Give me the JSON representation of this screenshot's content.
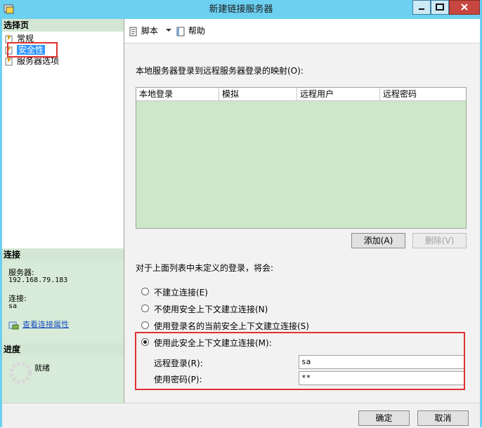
{
  "window": {
    "title": "新建链接服务器"
  },
  "left": {
    "select_page_header": "选择页",
    "pages": [
      {
        "label": "常规",
        "icon": "page-icon"
      },
      {
        "label": "安全性",
        "icon": "page-icon"
      },
      {
        "label": "服务器选项",
        "icon": "page-icon"
      }
    ],
    "connection": {
      "header": "连接",
      "server_label": "服务器:",
      "server_value": "192.168.79.183",
      "connection_label": "连接:",
      "connection_value": "sa",
      "view_props_link": "查看连接属性"
    },
    "progress": {
      "header": "进度",
      "status": "就绪"
    }
  },
  "toolbar": {
    "script_label": "脚本",
    "help_label": "帮助"
  },
  "main": {
    "mapping_label": "本地服务器登录到远程服务器登录的映射(O):",
    "columns": [
      "本地登录",
      "模拟",
      "远程用户",
      "远程密码"
    ],
    "add_button": "添加(A)",
    "delete_button": "删除(V)",
    "undefined_label": "对于上面列表中未定义的登录，将会:",
    "options": [
      "不建立连接(E)",
      "不使用安全上下文建立连接(N)",
      "使用登录名的当前安全上下文建立连接(S)",
      "使用此安全上下文建立连接(M):"
    ],
    "selected_option": 3,
    "remote_login_label": "远程登录(R):",
    "remote_login_value": "sa",
    "password_label": "使用密码(P):",
    "password_value": "**"
  },
  "footer": {
    "ok": "确定",
    "cancel": "取消"
  },
  "colors": {
    "titlebar": "#6cd0f0",
    "highlight_box": "#e03030",
    "grid_bg": "#cde8c8"
  }
}
